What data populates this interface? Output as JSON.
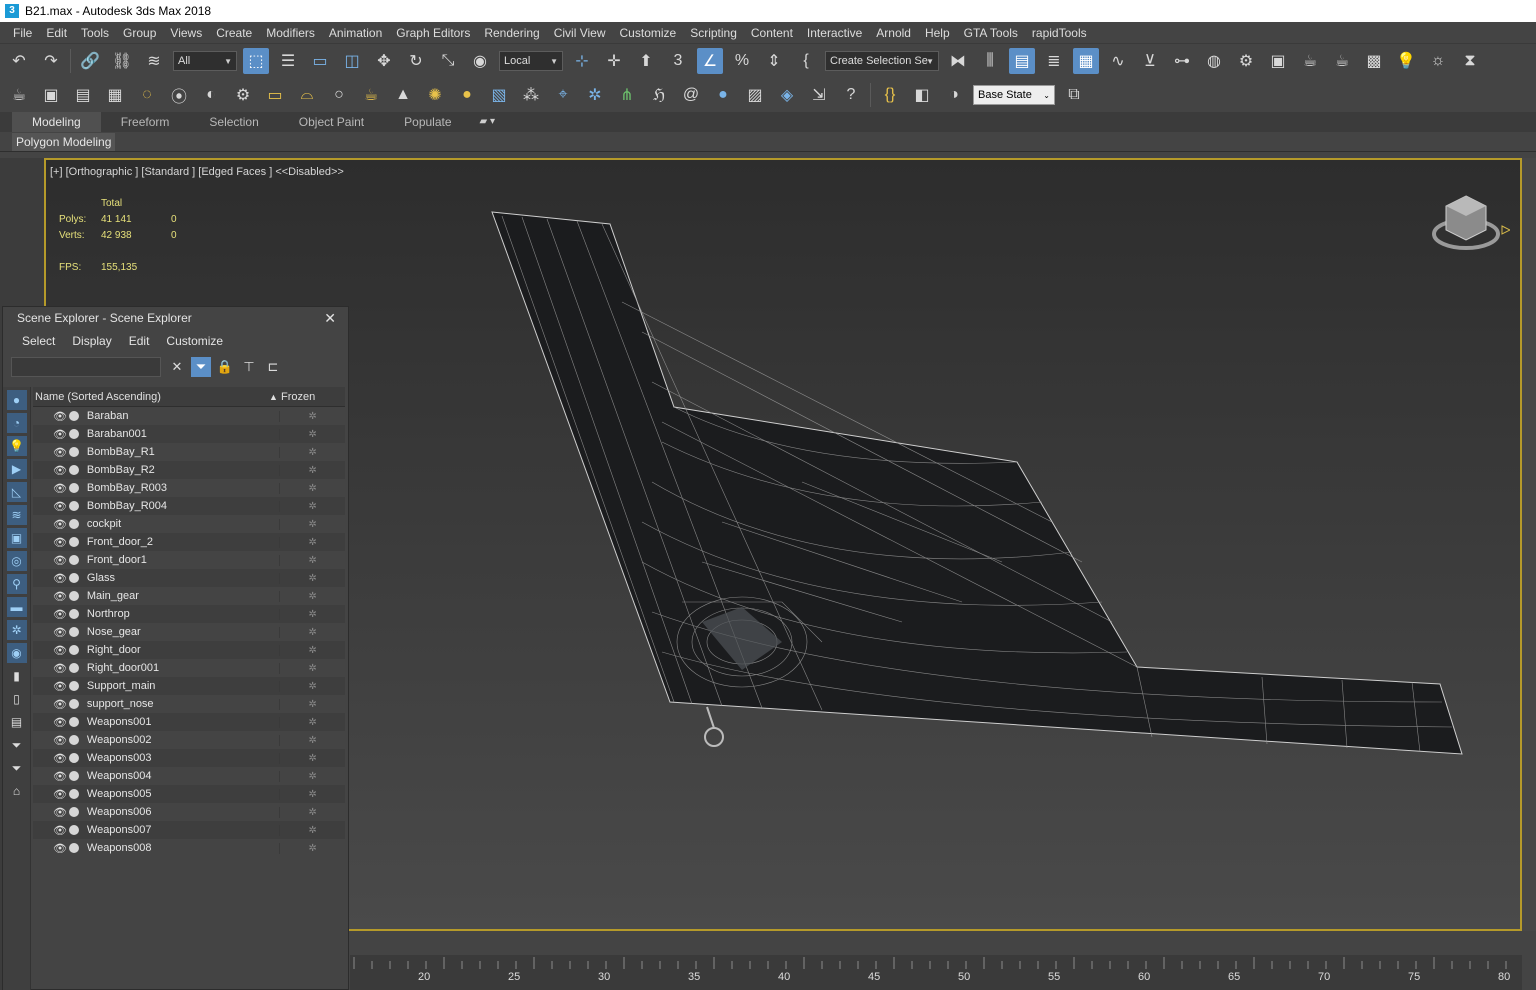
{
  "window": {
    "title": "B21.max - Autodesk 3ds Max 2018",
    "app_icon": "3"
  },
  "menu": [
    "File",
    "Edit",
    "Tools",
    "Group",
    "Views",
    "Create",
    "Modifiers",
    "Animation",
    "Graph Editors",
    "Rendering",
    "Civil View",
    "Customize",
    "Scripting",
    "Content",
    "Interactive",
    "Arnold",
    "Help",
    "GTA Tools",
    "rapidTools"
  ],
  "toolbar1": {
    "selection_filter": "All",
    "ref_coord": "Local",
    "snap_label": "3",
    "named_selection": "Create Selection Se"
  },
  "toolbar2": {
    "state_set": "Base State"
  },
  "ribbon": {
    "tabs": [
      "Modeling",
      "Freeform",
      "Selection",
      "Object Paint",
      "Populate"
    ],
    "active_tab": "Modeling",
    "sub_tab": "Polygon Modeling"
  },
  "viewport": {
    "label": "[+] [Orthographic ] [Standard ] [Edged Faces ]  <<Disabled>>",
    "stats": {
      "header": "Total",
      "polys_label": "Polys:",
      "polys_total": "41 141",
      "polys_sel": "0",
      "verts_label": "Verts:",
      "verts_total": "42 938",
      "verts_sel": "0",
      "fps_label": "FPS:",
      "fps": "155,135"
    }
  },
  "scene_explorer": {
    "title": "Scene Explorer - Scene Explorer",
    "menu": [
      "Select",
      "Display",
      "Edit",
      "Customize"
    ],
    "search_value": "",
    "columns": {
      "name": "Name (Sorted Ascending)",
      "frozen": "Frozen"
    },
    "items": [
      "Baraban",
      "Baraban001",
      "BombBay_R1",
      "BombBay_R2",
      "BombBay_R003",
      "BombBay_R004",
      "cockpit",
      "Front_door_2",
      "Front_door1",
      "Glass",
      "Main_gear",
      "Northrop",
      "Nose_gear",
      "Right_door",
      "Right_door001",
      "Support_main",
      "support_nose",
      "Weapons001",
      "Weapons002",
      "Weapons003",
      "Weapons004",
      "Weapons005",
      "Weapons006",
      "Weapons007",
      "Weapons008"
    ]
  },
  "timeline": {
    "labels": [
      "20",
      "25",
      "30",
      "35",
      "40",
      "45",
      "50",
      "55",
      "60",
      "65",
      "70",
      "75",
      "80"
    ]
  },
  "colors": {
    "viewport_border": "#b59a2a",
    "stats_text": "#e6e07a",
    "active_blue": "#5b8fc7"
  }
}
